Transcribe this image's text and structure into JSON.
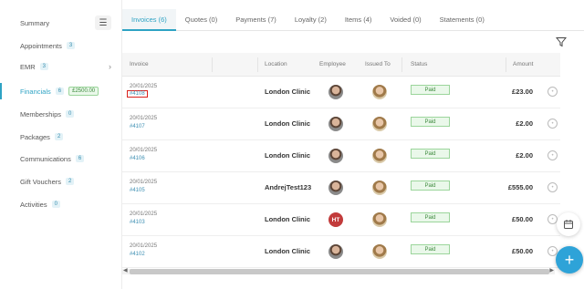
{
  "sidebar": {
    "summary": "Summary",
    "items": [
      {
        "label": "Appointments",
        "count": "3"
      },
      {
        "label": "EMR",
        "count": "3"
      },
      {
        "label": "Financials",
        "count": "6",
        "amount": "£2500.00"
      },
      {
        "label": "Memberships",
        "count": "0"
      },
      {
        "label": "Packages",
        "count": "2"
      },
      {
        "label": "Communications",
        "count": "6"
      },
      {
        "label": "Gift Vouchers",
        "count": "2"
      },
      {
        "label": "Activities",
        "count": "0"
      }
    ]
  },
  "tabs": [
    {
      "label": "Invoices (6)"
    },
    {
      "label": "Quotes (0)"
    },
    {
      "label": "Payments (7)"
    },
    {
      "label": "Loyalty (2)"
    },
    {
      "label": "Items (4)"
    },
    {
      "label": "Voided (0)"
    },
    {
      "label": "Statements (0)"
    }
  ],
  "table": {
    "headers": {
      "invoice": "Invoice",
      "location": "Location",
      "employee": "Employee",
      "issued_to": "Issued To",
      "status": "Status",
      "amount": "Amount"
    },
    "rows": [
      {
        "date": "20/01/2025",
        "number": "#4108",
        "location": "London Clinic",
        "employee_initials": "",
        "status": "Paid",
        "amount": "£23.00"
      },
      {
        "date": "20/01/2025",
        "number": "#4107",
        "location": "London Clinic",
        "employee_initials": "",
        "status": "Paid",
        "amount": "£2.00"
      },
      {
        "date": "20/01/2025",
        "number": "#4106",
        "location": "London Clinic",
        "employee_initials": "",
        "status": "Paid",
        "amount": "£2.00"
      },
      {
        "date": "20/01/2025",
        "number": "#4105",
        "location": "AndrejTest123",
        "employee_initials": "",
        "status": "Paid",
        "amount": "£555.00"
      },
      {
        "date": "20/01/2025",
        "number": "#4103",
        "location": "London Clinic",
        "employee_initials": "HT",
        "status": "Paid",
        "amount": "£50.00"
      },
      {
        "date": "20/01/2025",
        "number": "#4102",
        "location": "London Clinic",
        "employee_initials": "",
        "status": "Paid",
        "amount": "£50.00"
      }
    ]
  },
  "colors": {
    "accent": "#2ea3c4",
    "paid_bg": "#eaf8ea",
    "paid_border": "#9bd59b",
    "highlight_box": "#d9211c",
    "fab": "#2ea3d8"
  },
  "icons": {
    "menu": "hamburger-icon",
    "chevron": "chevron-right-icon",
    "filter": "filter-icon",
    "row_action": "circle-action-icon",
    "calendar": "calendar-icon",
    "add": "plus-icon"
  }
}
